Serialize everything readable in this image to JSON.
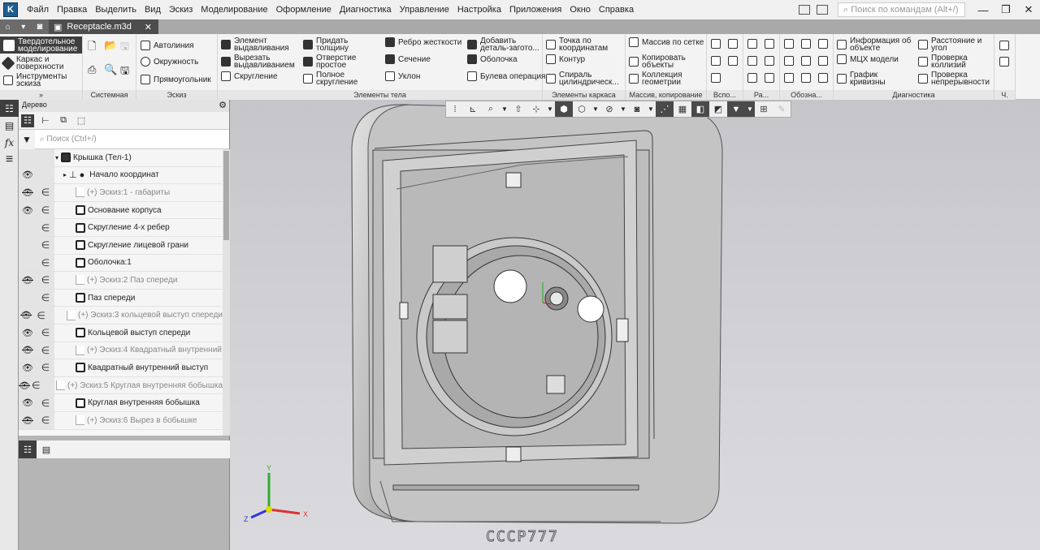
{
  "menu": [
    "Файл",
    "Правка",
    "Выделить",
    "Вид",
    "Эскиз",
    "Моделирование",
    "Оформление",
    "Диагностика",
    "Управление",
    "Настройка",
    "Приложения",
    "Окно",
    "Справка"
  ],
  "command_search_placeholder": "Поиск по командам (Alt+/)",
  "document_tab": "Receptacle.m3d",
  "modes": [
    "Твердотельное моделирование",
    "Каркас и поверхности",
    "Инструменты эскиза"
  ],
  "ribbon": {
    "system_label": "Системная",
    "sketch": {
      "label": "Эскиз",
      "items": [
        "Автолиния",
        "Окружность",
        "Прямоугольник"
      ]
    },
    "body": {
      "label": "Элементы тела",
      "items": [
        "Элемент выдавливания",
        "Вырезать выдавливанием",
        "Скругление",
        "Придать толщину",
        "Отверстие простое",
        "Полное скругление",
        "Ребро жесткости",
        "Сечение",
        "Уклон",
        "Добавить деталь-загото...",
        "Оболочка",
        "Булева операция"
      ]
    },
    "frame": {
      "label": "Элементы каркаса",
      "items": [
        "Точка по координатам",
        "Контур",
        "Спираль цилиндрическ..."
      ]
    },
    "array": {
      "label": "Массив, копирование",
      "items": [
        "Массив по сетке",
        "Копировать объекты",
        "Коллекция геометрии"
      ]
    },
    "small_groups": [
      "Вспо...",
      "Ра...",
      "Обозна..."
    ],
    "diag": {
      "label": "Диагностика",
      "items": [
        "Информация об объекте",
        "МЦХ модели",
        "График кривизны",
        "Расстояние и угол",
        "Проверка коллизий",
        "Проверка непрерывности"
      ]
    },
    "last_label": "Ч."
  },
  "tree": {
    "title": "Дерево",
    "search_placeholder": "Поиск (Ctrl+/)",
    "rows": [
      {
        "label": "Крышка (Тел-1)",
        "eye": "",
        "inc": "",
        "dim": false
      },
      {
        "label": "Начало координат",
        "eye": "visible",
        "inc": "",
        "dim": false
      },
      {
        "label": "(+) Эскиз:1 - габариты",
        "eye": "hidden",
        "inc": "∈",
        "dim": true
      },
      {
        "label": "Основание корпуса",
        "eye": "visible",
        "inc": "∈",
        "dim": false
      },
      {
        "label": "Скругление 4-х ребер",
        "eye": "",
        "inc": "∈",
        "dim": false
      },
      {
        "label": "Скругление лицевой грани",
        "eye": "",
        "inc": "∈",
        "dim": false
      },
      {
        "label": "Оболочка:1",
        "eye": "",
        "inc": "∈",
        "dim": false
      },
      {
        "label": "(+) Эскиз:2 Паз спереди",
        "eye": "hidden",
        "inc": "∈",
        "dim": true
      },
      {
        "label": "Паз спереди",
        "eye": "",
        "inc": "∈",
        "dim": false
      },
      {
        "label": "(+) Эскиз:3 кольцевой выступ спереди",
        "eye": "hidden",
        "inc": "∈",
        "dim": true
      },
      {
        "label": "Кольцевой выступ спереди",
        "eye": "visible",
        "inc": "∈",
        "dim": false
      },
      {
        "label": "(+) Эскиз:4 Квадратный внутренний",
        "eye": "hidden",
        "inc": "∈",
        "dim": true
      },
      {
        "label": "Квадратный внутренний выступ",
        "eye": "visible",
        "inc": "∈",
        "dim": false
      },
      {
        "label": "(+) Эскиз:5 Круглая внутренняя бобышка",
        "eye": "hidden",
        "inc": "∈",
        "dim": true
      },
      {
        "label": "Круглая внутренняя бобышка",
        "eye": "visible",
        "inc": "∈",
        "dim": false
      },
      {
        "label": "(+) Эскиз:6 Вырез в бобышке",
        "eye": "hidden",
        "inc": "∈",
        "dim": true
      }
    ]
  },
  "axes": {
    "x": "X",
    "y": "Y",
    "z": "Z"
  },
  "watermark": "СССР777"
}
